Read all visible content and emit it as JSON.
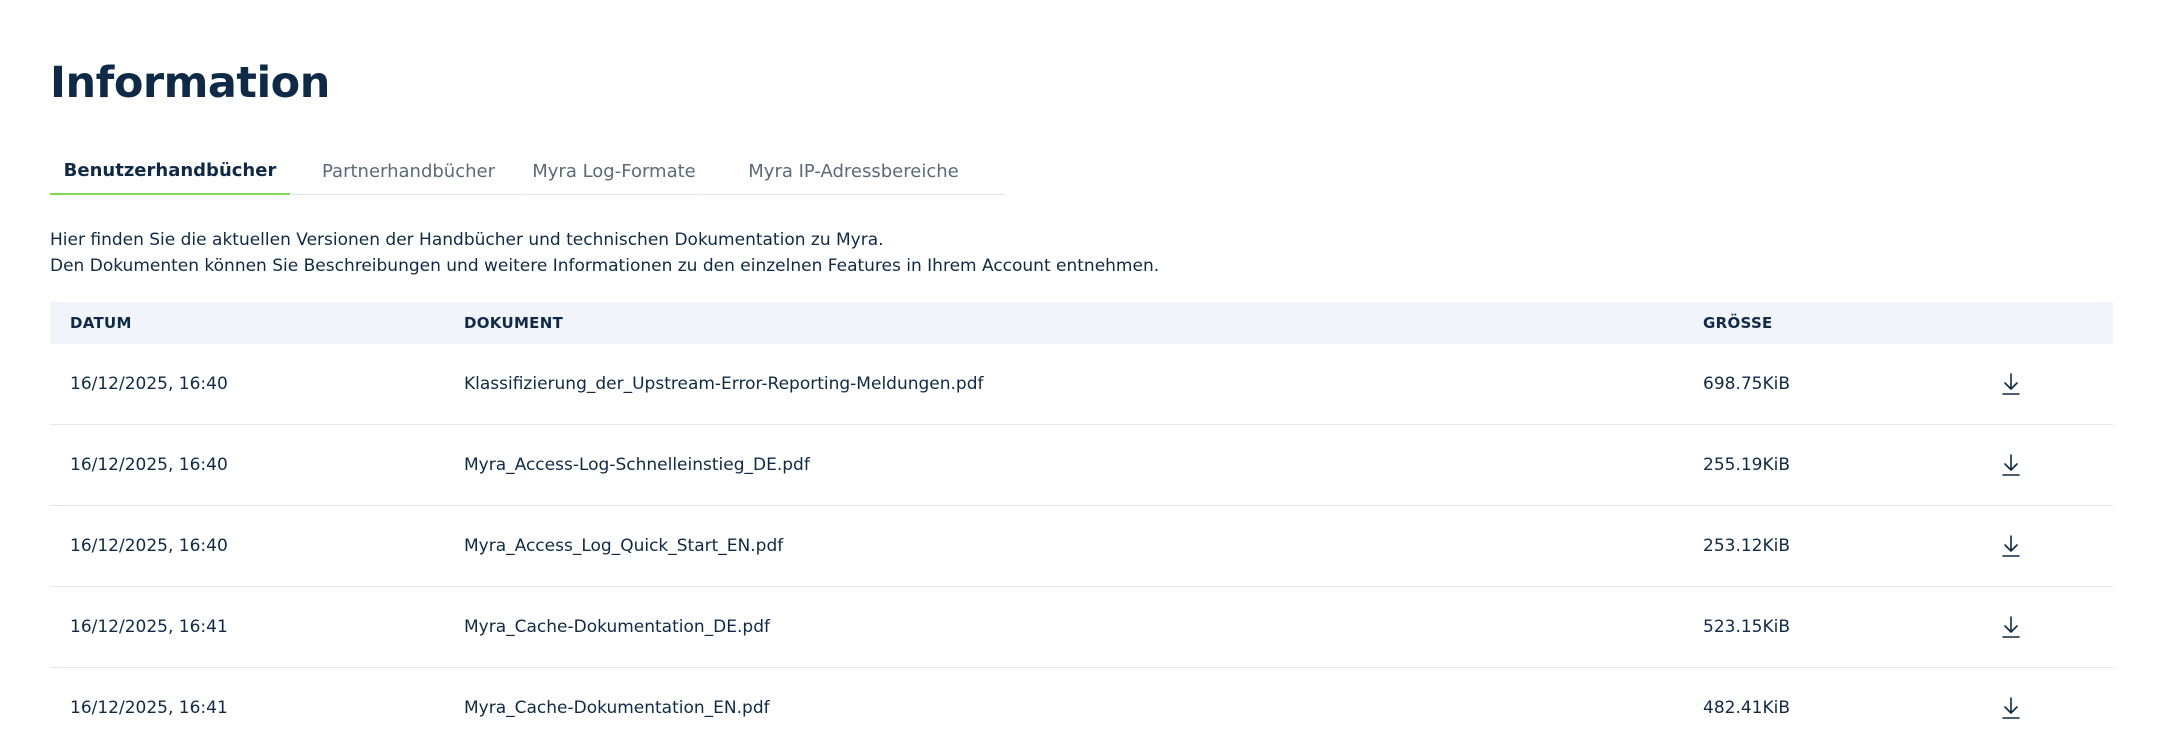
{
  "page": {
    "title": "Information"
  },
  "tabs": [
    {
      "label": "Benutzerhandbücher",
      "active": true
    },
    {
      "label": "Partnerhandbücher",
      "active": false
    },
    {
      "label": "Myra Log-Formate",
      "active": false
    },
    {
      "label": "Myra IP-Adressbereiche",
      "active": false
    }
  ],
  "intro": {
    "line1": "Hier finden Sie die aktuellen Versionen der Handbücher und technischen Dokumentation zu Myra.",
    "line2": "Den Dokumenten können Sie Beschreibungen und weitere Informationen zu den einzelnen Features in Ihrem Account entnehmen."
  },
  "table": {
    "headers": {
      "date": "DATUM",
      "document": "DOKUMENT",
      "size": "GRÖSSE"
    },
    "rows": [
      {
        "date": "16/12/2025, 16:40",
        "document": "Klassifizierung_der_Upstream-Error-Reporting-Meldungen.pdf",
        "size": "698.75KiB"
      },
      {
        "date": "16/12/2025, 16:40",
        "document": "Myra_Access-Log-Schnelleinstieg_DE.pdf",
        "size": "255.19KiB"
      },
      {
        "date": "16/12/2025, 16:40",
        "document": "Myra_Access_Log_Quick_Start_EN.pdf",
        "size": "253.12KiB"
      },
      {
        "date": "16/12/2025, 16:41",
        "document": "Myra_Cache-Dokumentation_DE.pdf",
        "size": "523.15KiB"
      },
      {
        "date": "16/12/2025, 16:41",
        "document": "Myra_Cache-Dokumentation_EN.pdf",
        "size": "482.41KiB"
      }
    ],
    "row_icon": "download-icon"
  },
  "colors": {
    "text": "#0e2a47",
    "muted": "#5b6b7c",
    "accent": "#7ed957",
    "header_bg": "#f1f4f8"
  }
}
